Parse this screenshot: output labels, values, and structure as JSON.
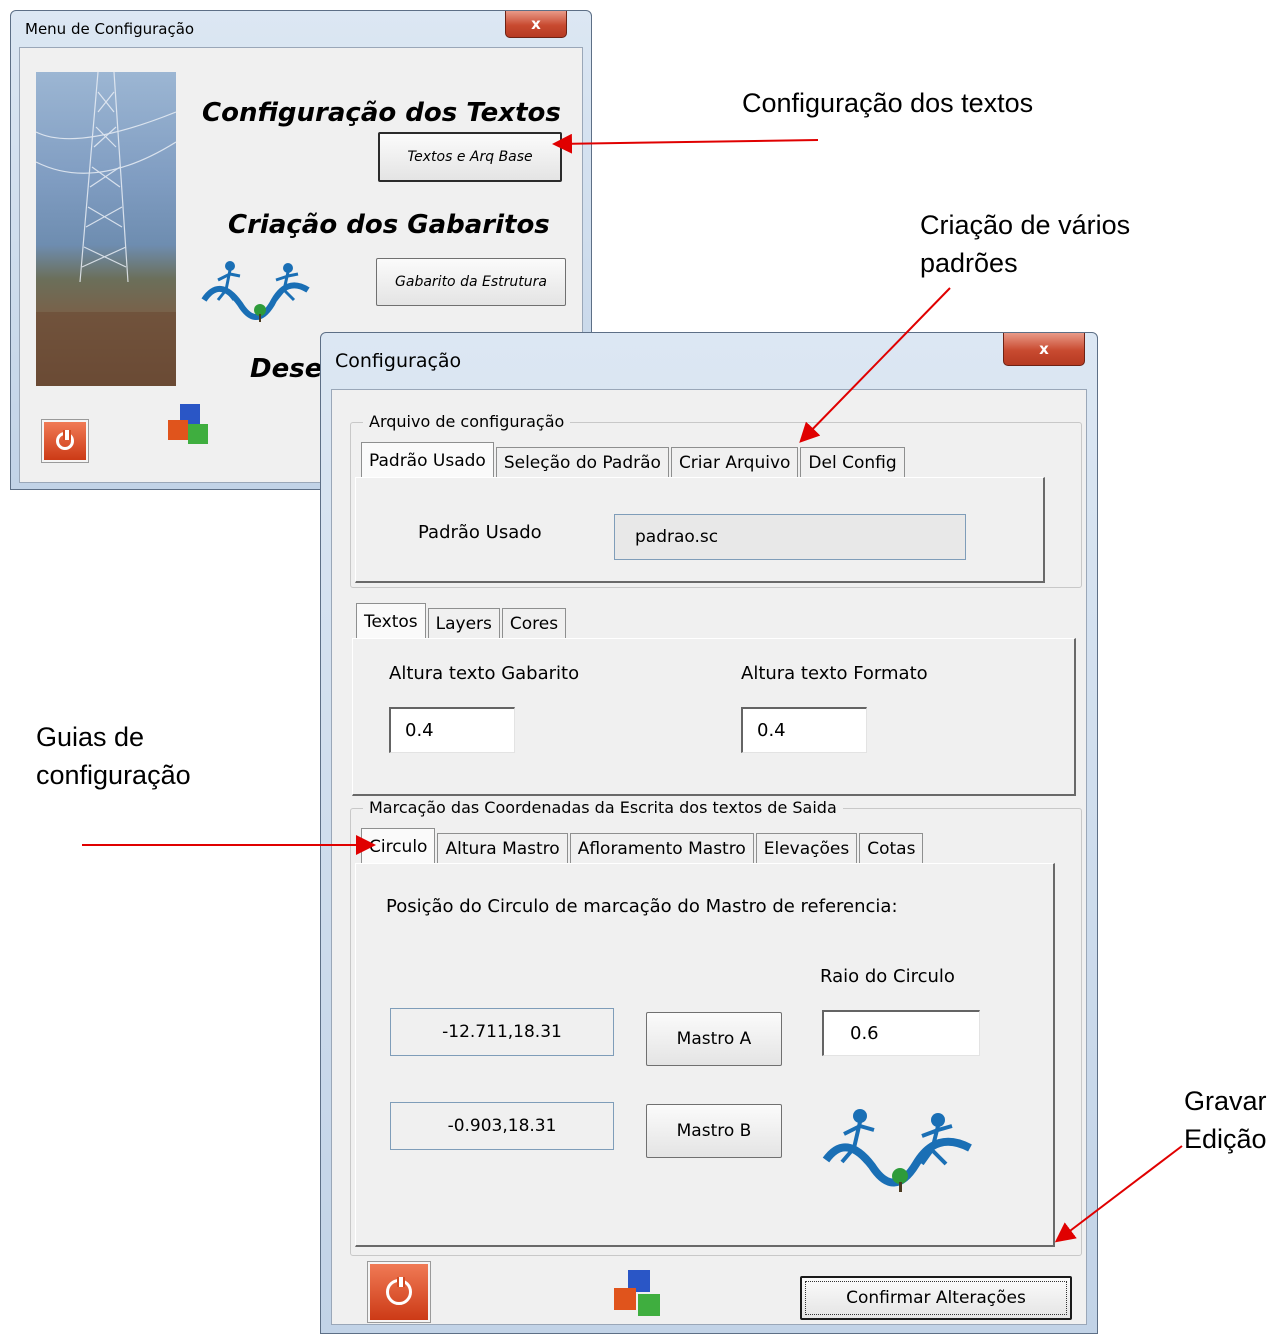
{
  "menu_window": {
    "title": "Menu de Configuração",
    "close_glyph": "x",
    "heading_texts": "Configuração dos Textos",
    "button_texts": "Textos e Arq Base",
    "heading_gabaritos": "Criação dos Gabaritos",
    "button_gabarito": "Gabarito da Estrutura",
    "heading_desenho_partial": "Dese"
  },
  "config_window": {
    "title": "Configuração",
    "close_glyph": "x",
    "arquivo_group": {
      "legend": "Arquivo de configuração",
      "tabs": [
        "Padrão Usado",
        "Seleção do Padrão",
        "Criar Arquivo",
        "Del Config"
      ],
      "active_tab": "Padrão Usado",
      "field_label": "Padrão  Usado",
      "field_value": "padrao.sc"
    },
    "text_tabs": {
      "tabs": [
        "Textos",
        "Layers",
        "Cores"
      ],
      "active_tab": "Textos",
      "altura_gabarito_label": "Altura texto Gabarito",
      "altura_gabarito_value": "0.4",
      "altura_formato_label": "Altura texto Formato",
      "altura_formato_value": "0.4"
    },
    "marcacao_group": {
      "legend": "Marcação das Coordenadas da Escrita dos textos de Saida",
      "tabs": [
        "Circulo",
        "Altura Mastro",
        "Afloramento Mastro",
        "Elevações",
        "Cotas"
      ],
      "active_tab": "Circulo",
      "description": "Posição do Circulo de marcação do Mastro de referencia:",
      "coord_a": "-12.711,18.31",
      "coord_b": "-0.903,18.31",
      "mastro_a_label": "Mastro A",
      "mastro_b_label": "Mastro B",
      "raio_label": "Raio do Circulo",
      "raio_value": "0.6"
    },
    "confirm_button": "Confirmar Alterações"
  },
  "annotations": {
    "config_textos": "Configuração dos textos",
    "criacao_padroes": "Criação de vários padrões",
    "guias": "Guias de configuração",
    "gravar": "Gravar Edição"
  },
  "colors": {
    "arrow": "#e00000",
    "close_button": "#c84a30",
    "power_button": "#d8401a",
    "window_background": "#f0f0f0"
  }
}
